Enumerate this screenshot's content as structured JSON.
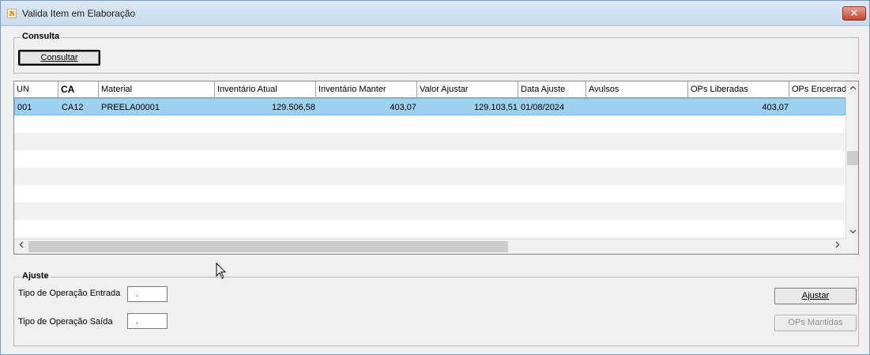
{
  "window": {
    "title": "Valida Item em Elaboração",
    "close_glyph": "✕"
  },
  "consulta": {
    "legend": "Consulta",
    "button_label": "Consultar"
  },
  "grid": {
    "columns": [
      "UN",
      "CA",
      "Material",
      "Inventário Atual",
      "Inventário Manter",
      "Valor Ajustar",
      "Data Ajuste",
      "Avulsos",
      "OPs Liberadas",
      "OPs Encerradas"
    ],
    "rows": [
      [
        "001",
        "CA12",
        "PREELA00001",
        "129.506,58",
        "403,07",
        "129.103,51",
        "01/08/2024",
        "",
        "403,07",
        ""
      ]
    ],
    "scroll_left": "<",
    "scroll_right": ">",
    "scroll_up": "^",
    "scroll_down": "v"
  },
  "ajuste": {
    "legend": "Ajuste",
    "entrada_label": "Tipo de Operação Entrada",
    "entrada_value": ".",
    "saida_label": "Tipo de Operação Saída",
    "saida_value": ".",
    "ajustar_label": "Ajustar",
    "ops_mantidas_label": "OPs Mantidas"
  },
  "colors": {
    "selected_row": "#9ed0f0",
    "titlebar": "#c9dcef",
    "close": "#c7452f"
  }
}
